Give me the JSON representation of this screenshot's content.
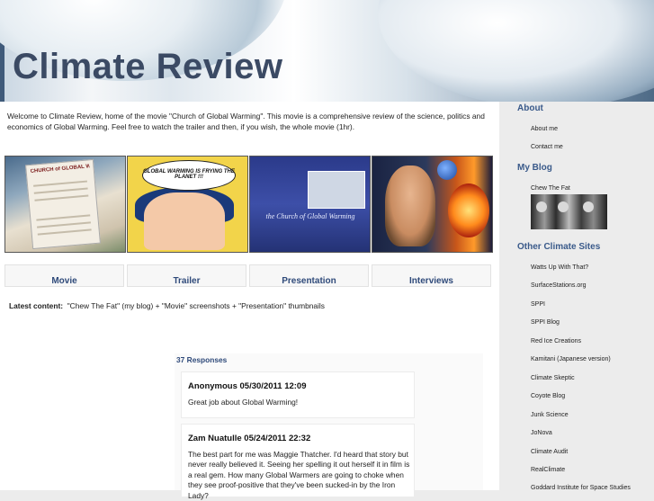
{
  "header": {
    "title": "Climate Review"
  },
  "intro": {
    "text": "Welcome to Climate Review, home of the movie \"Church of Global Warming\".  This movie is a comprehensive review of the science, politics and economics of Global Warming.  Feel free to watch the trailer and then, if you wish, the whole movie (1hr)."
  },
  "thumbnails": {
    "movie_poster_text": "CHURCH of GLOBAL WARMING",
    "trailer_bubble": "GLOBAL WARMING IS FRYING THE PLANET !!!",
    "presentation_label": "the Church of Global Warming"
  },
  "tabs": [
    {
      "label": "Movie"
    },
    {
      "label": "Trailer"
    },
    {
      "label": "Presentation"
    },
    {
      "label": "Interviews"
    }
  ],
  "latest": {
    "label": "Latest content:",
    "text": "\"Chew The Fat\" (my blog) + \"Movie\" screenshots + \"Presentation\" thumbnails"
  },
  "comments": {
    "count_label": "37 Responses",
    "items": [
      {
        "author": "Anonymous 05/30/2011 12:09",
        "text": "Great job about Global Warming!"
      },
      {
        "author": "Zam Nuatulle 05/24/2011 22:32",
        "text": "The best part for me was Maggie Thatcher. I'd heard that story but never really believed it. Seeing her spelling it out herself it in film is a real gem. How many Global Warmers are going to choke when they see proof-positive that they've been sucked-in by the Iron Lady?"
      }
    ]
  },
  "sidebar": {
    "about": {
      "heading": "About",
      "links": [
        "About me",
        "Contact me"
      ]
    },
    "blog": {
      "heading": "My Blog",
      "links": [
        "Chew The Fat"
      ]
    },
    "sites": {
      "heading": "Other Climate Sites",
      "links": [
        "Watts Up With That?",
        "SurfaceStations.org",
        "SPPI",
        "SPPI Blog",
        "Red Ice Creations",
        "Kamitani (Japanese version)",
        "Climate Skeptic",
        "Coyote Blog",
        "Junk Science",
        "JoNova",
        "Climate Audit",
        "RealClimate",
        "Goddard Institute for Space Studies"
      ]
    }
  }
}
